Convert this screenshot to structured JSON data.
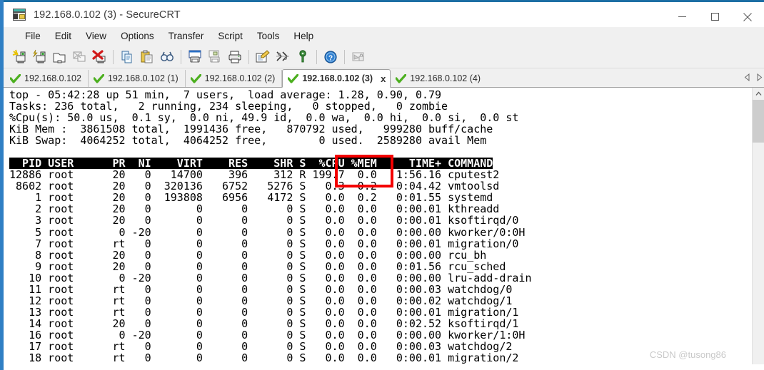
{
  "window": {
    "title": "192.168.0.102 (3) - SecureCRT",
    "icon": "securecrt-icon",
    "minimize_label": "–",
    "maximize_label": "□",
    "close_label": "✕"
  },
  "menubar": {
    "items": [
      {
        "label": "File"
      },
      {
        "label": "Edit"
      },
      {
        "label": "View"
      },
      {
        "label": "Options"
      },
      {
        "label": "Transfer"
      },
      {
        "label": "Script"
      },
      {
        "label": "Tools"
      },
      {
        "label": "Help"
      }
    ]
  },
  "toolbar": {
    "buttons": [
      {
        "name": "new-session-icon",
        "tooltip": "New Session"
      },
      {
        "name": "quick-connect-icon",
        "tooltip": "Quick Connect"
      },
      {
        "name": "connect-in-tab-icon",
        "tooltip": "Connect in Tab"
      },
      {
        "name": "reconnect-icon",
        "tooltip": "Reconnect"
      },
      {
        "name": "disconnect-icon",
        "tooltip": "Disconnect"
      },
      {
        "name": "copy-icon",
        "tooltip": "Copy"
      },
      {
        "name": "paste-icon",
        "tooltip": "Paste"
      },
      {
        "name": "find-icon",
        "tooltip": "Find"
      },
      {
        "name": "print-screen-icon",
        "tooltip": "Print Screen"
      },
      {
        "name": "print-selection-icon",
        "tooltip": "Print Selection"
      },
      {
        "name": "print-icon",
        "tooltip": "Print"
      },
      {
        "name": "log-session-icon",
        "tooltip": "Log Session"
      },
      {
        "name": "session-options-icon",
        "tooltip": "Session Options"
      },
      {
        "name": "key-icon",
        "tooltip": "Key"
      },
      {
        "name": "help-icon",
        "tooltip": "Help"
      },
      {
        "name": "lock-screen-icon",
        "tooltip": "Lock Screen"
      }
    ]
  },
  "tabs": {
    "items": [
      {
        "label": "192.168.0.102",
        "active": false,
        "status": "connected"
      },
      {
        "label": "192.168.0.102 (1)",
        "active": false,
        "status": "connected"
      },
      {
        "label": "192.168.0.102 (2)",
        "active": false,
        "status": "connected"
      },
      {
        "label": "192.168.0.102 (3)",
        "active": true,
        "status": "connected",
        "close_label": "x"
      },
      {
        "label": "192.168.0.102 (4)",
        "active": false,
        "status": "connected"
      }
    ],
    "scroll_left_icon": "triangle-left-icon",
    "scroll_right_icon": "triangle-right-icon"
  },
  "terminal": {
    "summary": {
      "uptime_line": "top - 05:42:28 up 51 min,  7 users,  load average: 1.28, 0.90, 0.79",
      "tasks_line": "Tasks: 236 total,   2 running, 234 sleeping,   0 stopped,   0 zombie",
      "cpu_line": "%Cpu(s): 50.0 us,  0.1 sy,  0.0 ni, 49.9 id,  0.0 wa,  0.0 hi,  0.0 si,  0.0 st",
      "mem_line": "KiB Mem :  3861508 total,  1991436 free,   870792 used,   999280 buff/cache",
      "swap_line": "KiB Swap:  4064252 total,  4064252 free,        0 used.  2589280 avail Mem"
    },
    "columns": [
      "PID",
      "USER",
      "PR",
      "NI",
      "VIRT",
      "RES",
      "SHR",
      "S",
      "%CPU",
      "%MEM",
      "TIME+",
      "COMMAND"
    ],
    "header_row": "  PID USER      PR  NI    VIRT    RES    SHR S  %CPU %MEM     TIME+ COMMAND",
    "rows": [
      {
        "pid": "12886",
        "user": "root",
        "pr": "20",
        "ni": "0",
        "virt": "14700",
        "res": "396",
        "shr": "312",
        "s": "R",
        "cpu": "199.7",
        "mem": "0.0",
        "time": "1:56.16",
        "command": "cputest2",
        "highlight": true
      },
      {
        "pid": "8602",
        "user": "root",
        "pr": "20",
        "ni": "0",
        "virt": "320136",
        "res": "6752",
        "shr": "5276",
        "s": "S",
        "cpu": "0.3",
        "mem": "0.2",
        "time": "0:04.42",
        "command": "vmtoolsd",
        "highlight": false
      },
      {
        "pid": "1",
        "user": "root",
        "pr": "20",
        "ni": "0",
        "virt": "193808",
        "res": "6956",
        "shr": "4172",
        "s": "S",
        "cpu": "0.0",
        "mem": "0.2",
        "time": "0:01.55",
        "command": "systemd",
        "highlight": false
      },
      {
        "pid": "2",
        "user": "root",
        "pr": "20",
        "ni": "0",
        "virt": "0",
        "res": "0",
        "shr": "0",
        "s": "S",
        "cpu": "0.0",
        "mem": "0.0",
        "time": "0:00.01",
        "command": "kthreadd",
        "highlight": false
      },
      {
        "pid": "3",
        "user": "root",
        "pr": "20",
        "ni": "0",
        "virt": "0",
        "res": "0",
        "shr": "0",
        "s": "S",
        "cpu": "0.0",
        "mem": "0.0",
        "time": "0:00.01",
        "command": "ksoftirqd/0",
        "highlight": false
      },
      {
        "pid": "5",
        "user": "root",
        "pr": "0",
        "ni": "-20",
        "virt": "0",
        "res": "0",
        "shr": "0",
        "s": "S",
        "cpu": "0.0",
        "mem": "0.0",
        "time": "0:00.00",
        "command": "kworker/0:0H",
        "highlight": false
      },
      {
        "pid": "7",
        "user": "root",
        "pr": "rt",
        "ni": "0",
        "virt": "0",
        "res": "0",
        "shr": "0",
        "s": "S",
        "cpu": "0.0",
        "mem": "0.0",
        "time": "0:00.01",
        "command": "migration/0",
        "highlight": false
      },
      {
        "pid": "8",
        "user": "root",
        "pr": "20",
        "ni": "0",
        "virt": "0",
        "res": "0",
        "shr": "0",
        "s": "S",
        "cpu": "0.0",
        "mem": "0.0",
        "time": "0:00.00",
        "command": "rcu_bh",
        "highlight": false
      },
      {
        "pid": "9",
        "user": "root",
        "pr": "20",
        "ni": "0",
        "virt": "0",
        "res": "0",
        "shr": "0",
        "s": "S",
        "cpu": "0.0",
        "mem": "0.0",
        "time": "0:01.56",
        "command": "rcu_sched",
        "highlight": false
      },
      {
        "pid": "10",
        "user": "root",
        "pr": "0",
        "ni": "-20",
        "virt": "0",
        "res": "0",
        "shr": "0",
        "s": "S",
        "cpu": "0.0",
        "mem": "0.0",
        "time": "0:00.00",
        "command": "lru-add-drain",
        "highlight": false
      },
      {
        "pid": "11",
        "user": "root",
        "pr": "rt",
        "ni": "0",
        "virt": "0",
        "res": "0",
        "shr": "0",
        "s": "S",
        "cpu": "0.0",
        "mem": "0.0",
        "time": "0:00.03",
        "command": "watchdog/0",
        "highlight": false
      },
      {
        "pid": "12",
        "user": "root",
        "pr": "rt",
        "ni": "0",
        "virt": "0",
        "res": "0",
        "shr": "0",
        "s": "S",
        "cpu": "0.0",
        "mem": "0.0",
        "time": "0:00.02",
        "command": "watchdog/1",
        "highlight": false
      },
      {
        "pid": "13",
        "user": "root",
        "pr": "rt",
        "ni": "0",
        "virt": "0",
        "res": "0",
        "shr": "0",
        "s": "S",
        "cpu": "0.0",
        "mem": "0.0",
        "time": "0:00.01",
        "command": "migration/1",
        "highlight": false
      },
      {
        "pid": "14",
        "user": "root",
        "pr": "20",
        "ni": "0",
        "virt": "0",
        "res": "0",
        "shr": "0",
        "s": "S",
        "cpu": "0.0",
        "mem": "0.0",
        "time": "0:02.52",
        "command": "ksoftirqd/1",
        "highlight": false
      },
      {
        "pid": "16",
        "user": "root",
        "pr": "0",
        "ni": "-20",
        "virt": "0",
        "res": "0",
        "shr": "0",
        "s": "S",
        "cpu": "0.0",
        "mem": "0.0",
        "time": "0:00.00",
        "command": "kworker/1:0H",
        "highlight": false
      },
      {
        "pid": "17",
        "user": "root",
        "pr": "rt",
        "ni": "0",
        "virt": "0",
        "res": "0",
        "shr": "0",
        "s": "S",
        "cpu": "0.0",
        "mem": "0.0",
        "time": "0:00.03",
        "command": "watchdog/2",
        "highlight": false
      },
      {
        "pid": "18",
        "user": "root",
        "pr": "rt",
        "ni": "0",
        "virt": "0",
        "res": "0",
        "shr": "0",
        "s": "S",
        "cpu": "0.0",
        "mem": "0.0",
        "time": "0:00.01",
        "command": "migration/2",
        "highlight": false
      }
    ],
    "body_text": "12886 root      20   0   14700    396    312 R 199.7  0.0   1:56.16 cputest2\n 8602 root      20   0  320136   6752   5276 S   0.3  0.2   0:04.42 vmtoolsd\n    1 root      20   0  193808   6956   4172 S   0.0  0.2   0:01.55 systemd\n    2 root      20   0       0      0      0 S   0.0  0.0   0:00.01 kthreadd\n    3 root      20   0       0      0      0 S   0.0  0.0   0:00.01 ksoftirqd/0\n    5 root       0 -20       0      0      0 S   0.0  0.0   0:00.00 kworker/0:0H\n    7 root      rt   0       0      0      0 S   0.0  0.0   0:00.01 migration/0\n    8 root      20   0       0      0      0 S   0.0  0.0   0:00.00 rcu_bh\n    9 root      20   0       0      0      0 S   0.0  0.0   0:01.56 rcu_sched\n   10 root       0 -20       0      0      0 S   0.0  0.0   0:00.00 lru-add-drain\n   11 root      rt   0       0      0      0 S   0.0  0.0   0:00.03 watchdog/0\n   12 root      rt   0       0      0      0 S   0.0  0.0   0:00.02 watchdog/1\n   13 root      rt   0       0      0      0 S   0.0  0.0   0:00.01 migration/1\n   14 root      20   0       0      0      0 S   0.0  0.0   0:02.52 ksoftirqd/1\n   16 root       0 -20       0      0      0 S   0.0  0.0   0:00.00 kworker/1:0H\n   17 root      rt   0       0      0      0 S   0.0  0.0   0:00.03 watchdog/2\n   18 root      rt   0       0      0      0 S   0.0  0.0   0:00.01 migration/2",
    "annotation": {
      "name": "cpu-column-highlight",
      "color": "#f40000",
      "target": "%CPU"
    }
  },
  "scrollbar": {
    "up_arrow": "∧",
    "down_arrow": "∨"
  },
  "watermark": {
    "text": "CSDN @tusong86"
  }
}
